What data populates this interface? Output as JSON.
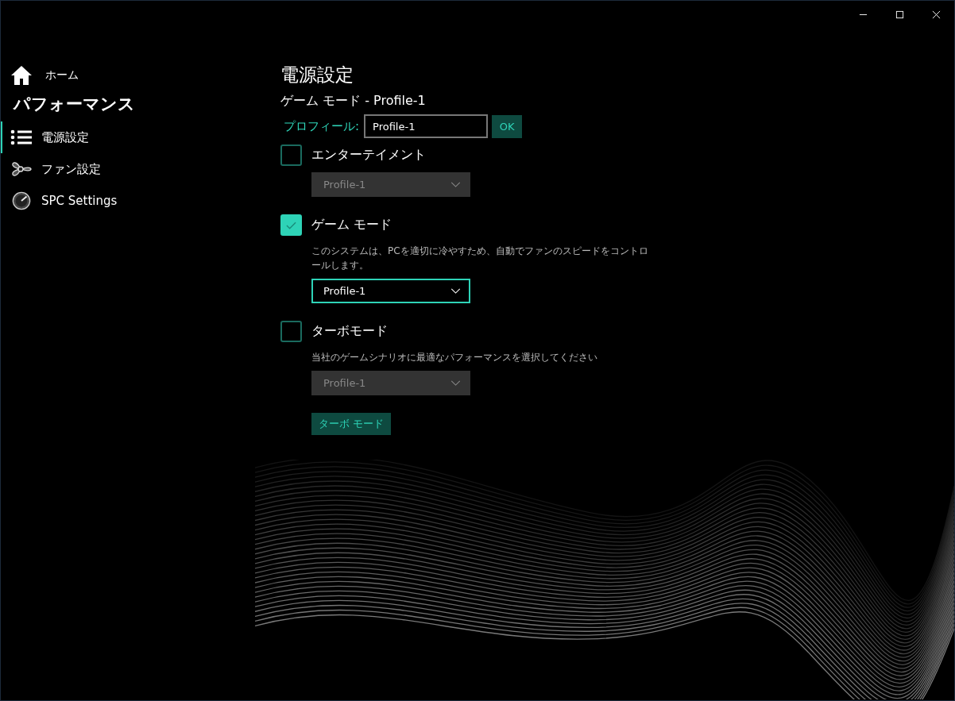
{
  "sidebar": {
    "items": [
      {
        "kind": "link",
        "label": "ホーム",
        "selected": false
      },
      {
        "kind": "heading",
        "label": "パフォーマンス"
      },
      {
        "kind": "nav",
        "label": "電源設定",
        "selected": true
      },
      {
        "kind": "nav",
        "label": "ファン設定",
        "selected": false
      },
      {
        "kind": "nav",
        "label": "SPC Settings",
        "selected": false
      }
    ]
  },
  "main": {
    "title": "電源設定",
    "subtitle": "ゲーム モード - Profile-1",
    "profile": {
      "label": "プロフィール:",
      "value": "Profile-1",
      "button": "OK"
    },
    "options": [
      {
        "label": "エンターテイメント",
        "checked": false,
        "dropdown": {
          "value": "Profile-1",
          "disabled": true
        }
      },
      {
        "label": "ゲーム モード",
        "checked": true,
        "description": "このシステムは、PCを適切に冷やすため、自動でファンのスピードをコントロールします。",
        "dropdown": {
          "value": "Profile-1",
          "disabled": false
        }
      },
      {
        "label": "ターボモード",
        "checked": false,
        "description": "当社のゲームシナリオに最適なパフォーマンスを選択してください",
        "dropdown": {
          "value": "Profile-1",
          "disabled": true
        }
      }
    ],
    "action_button": "ターボ モード"
  }
}
